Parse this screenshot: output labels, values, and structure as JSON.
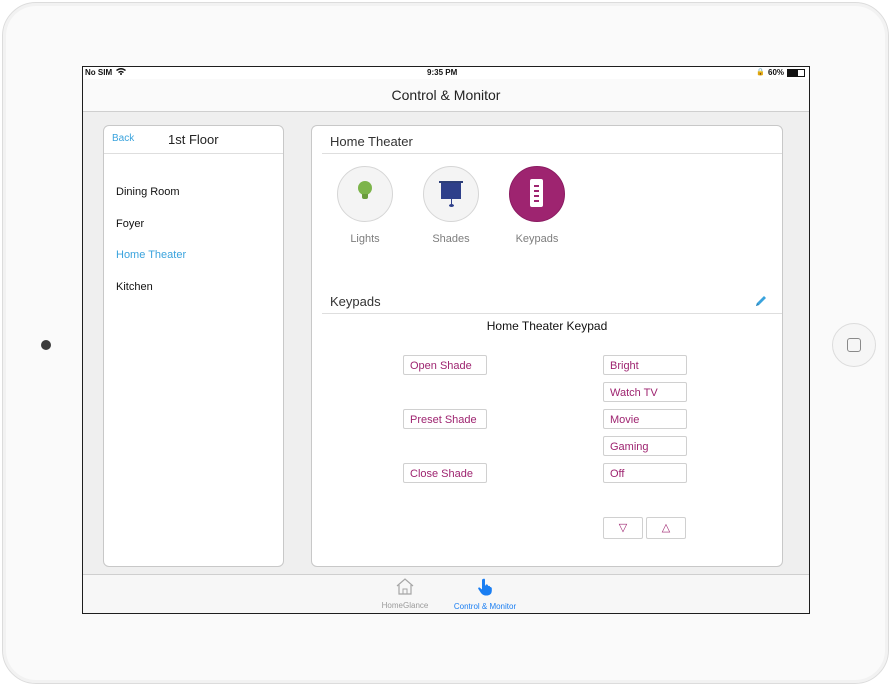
{
  "status_bar": {
    "carrier": "No SIM",
    "time": "9:35 PM",
    "battery": "60%",
    "battery_level": 0.6
  },
  "nav": {
    "title": "Control & Monitor"
  },
  "sidebar": {
    "back_label": "Back",
    "title": "1st Floor",
    "rooms": [
      {
        "label": "Dining Room",
        "active": false
      },
      {
        "label": "Foyer",
        "active": false
      },
      {
        "label": "Home Theater",
        "active": true
      },
      {
        "label": "Kitchen",
        "active": false
      }
    ]
  },
  "room": {
    "title": "Home Theater",
    "devices": [
      {
        "label": "Lights",
        "icon": "lightbulb-icon",
        "active": false
      },
      {
        "label": "Shades",
        "icon": "shade-icon",
        "active": false
      },
      {
        "label": "Keypads",
        "icon": "keypad-icon",
        "active": true
      }
    ]
  },
  "keypads": {
    "section_title": "Keypads",
    "keypad_name": "Home Theater Keypad",
    "left_buttons": [
      "Open Shade",
      "Preset Shade",
      "Close Shade"
    ],
    "right_buttons": [
      "Bright",
      "Watch TV",
      "Movie",
      "Gaming",
      "Off"
    ],
    "arrow_down": "▽",
    "arrow_up": "△"
  },
  "tabbar": {
    "tabs": [
      {
        "label": "HomeGlance",
        "icon": "house-icon",
        "active": false
      },
      {
        "label": "Control & Monitor",
        "icon": "hand-pointer-icon",
        "active": true
      }
    ]
  },
  "colors": {
    "accent": "#3aa3dd",
    "keypad_accent": "#9e2470",
    "tab_active": "#1a7ef2"
  }
}
